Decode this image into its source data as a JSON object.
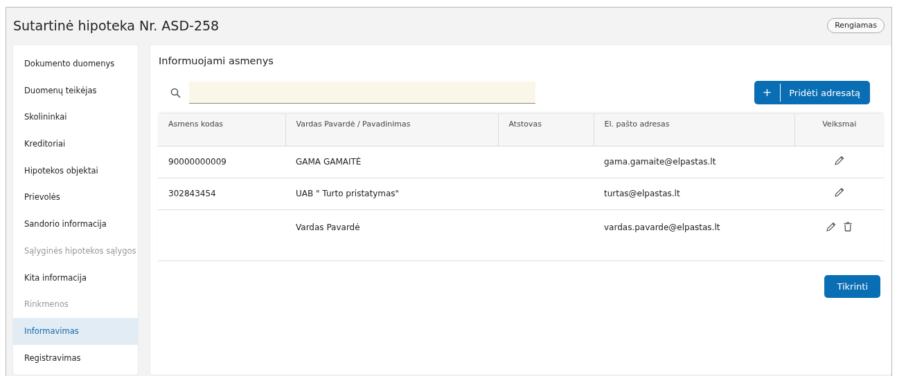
{
  "header": {
    "title": "Sutartinė hipoteka Nr. ASD-258",
    "status": "Rengiamas"
  },
  "sidebar": {
    "items": [
      {
        "label": "Dokumento duomenys",
        "selected": false,
        "disabled": false
      },
      {
        "label": "Duomenų teikėjas",
        "selected": false,
        "disabled": false
      },
      {
        "label": "Skolininkai",
        "selected": false,
        "disabled": false
      },
      {
        "label": "Kreditoriai",
        "selected": false,
        "disabled": false
      },
      {
        "label": "Hipotekos objektai",
        "selected": false,
        "disabled": false
      },
      {
        "label": "Prievolės",
        "selected": false,
        "disabled": false
      },
      {
        "label": "Sandorio informacija",
        "selected": false,
        "disabled": false
      },
      {
        "label": "Sąlyginės hipotekos sąlygos",
        "selected": false,
        "disabled": true
      },
      {
        "label": "Kita informacija",
        "selected": false,
        "disabled": false
      },
      {
        "label": "Rinkmenos",
        "selected": false,
        "disabled": true
      },
      {
        "label": "Informavimas",
        "selected": true,
        "disabled": false
      },
      {
        "label": "Registravimas",
        "selected": false,
        "disabled": false
      }
    ]
  },
  "panel": {
    "title": "Informuojami asmenys",
    "add_button": {
      "icon": "+",
      "label": "Pridėti adresatą"
    },
    "table": {
      "columns": [
        "Asmens kodas",
        "Vardas Pavardė / Pavadinimas",
        "Atstovas",
        "El. pašto adresas",
        "Veiksmai"
      ],
      "rows": [
        {
          "code": "90000000009",
          "name": "GAMA GAMAITĖ",
          "email": "gama.gamaite@elpastas.lt",
          "deletable": false
        },
        {
          "code": "302843454",
          "name": "UAB \" Turto pristatymas\"",
          "email": "turtas@elpastas.lt",
          "deletable": false
        },
        {
          "name": "Vardas Pavardė",
          "email": "vardas.pavarde@elpastas.lt",
          "deletable": true
        }
      ]
    },
    "check_button": "Tikrinti"
  }
}
